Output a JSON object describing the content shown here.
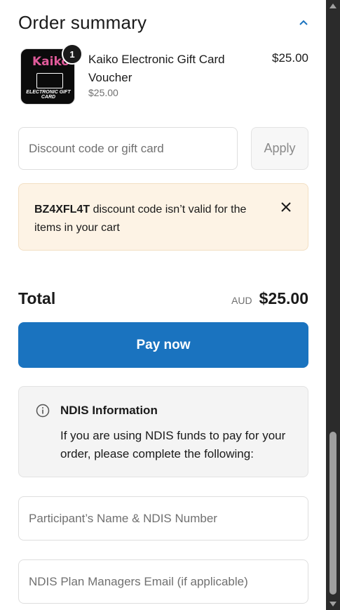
{
  "summary": {
    "title": "Order summary",
    "toggle_icon": "chevron-up-icon"
  },
  "product": {
    "name": "Kaiko Electronic Gift Card Voucher",
    "unit_price": "$25.00",
    "price": "$25.00",
    "quantity": "1",
    "thumbnail_logo": "Kaiko",
    "thumbnail_caption": "ELECTRONIC GIFT CARD"
  },
  "discount": {
    "placeholder": "Discount code or gift card",
    "apply_label": "Apply"
  },
  "alert": {
    "code": "BZ4XFL4T",
    "message": " discount code isn’t valid for the items in your cart",
    "close_icon": "close-icon"
  },
  "total": {
    "label": "Total",
    "currency": "AUD",
    "amount": "$25.00"
  },
  "pay": {
    "label": "Pay now",
    "color": "#1a73bf"
  },
  "ndis": {
    "icon": "info-icon",
    "title": "NDIS Information",
    "body": "If you are using NDIS funds to pay for your order, please complete the following:"
  },
  "fields": {
    "participant_placeholder": "Participant’s Name & NDIS Number",
    "plan_manager_placeholder": "NDIS Plan Managers Email (if applicable)"
  }
}
